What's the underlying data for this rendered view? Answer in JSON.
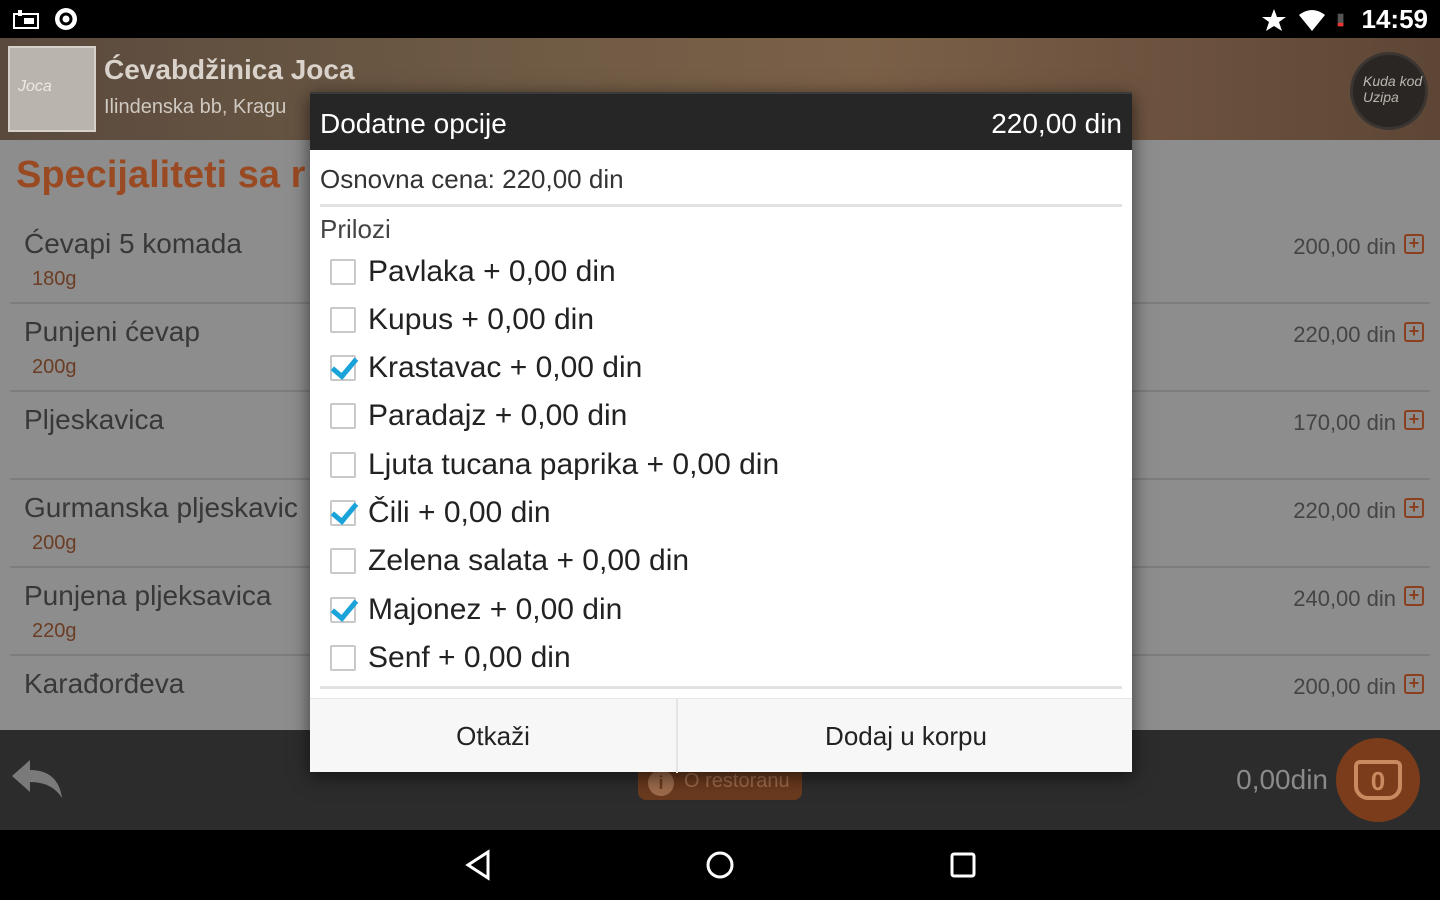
{
  "status_bar": {
    "time": "14:59",
    "left_icons": [
      "storage-icon",
      "sync-icon"
    ],
    "right_icons": [
      "star-icon",
      "wifi-icon",
      "battery-icon"
    ]
  },
  "header": {
    "restaurant_name": "Ćevabdžinica Joca",
    "address": "Ilindenska bb, Kragu",
    "logo_text": "Joca",
    "badge_text": "Kuda kod Uzipa"
  },
  "menu": {
    "section_title": "Specijaliteti sa r",
    "items": [
      {
        "name": "Ćevapi 5 komada",
        "weight": "180g",
        "price": "200,00 din"
      },
      {
        "name": "Punjeni ćevap",
        "weight": "200g",
        "price": "220,00 din"
      },
      {
        "name": "Pljeskavica",
        "weight": "",
        "price": "170,00 din"
      },
      {
        "name": "Gurmanska pljeskavic",
        "weight": "200g",
        "price": "220,00 din"
      },
      {
        "name": "Punjena pljeksavica",
        "weight": "220g",
        "price": "240,00 din"
      },
      {
        "name": "Karađorđeva",
        "weight": "",
        "price": "200,00 din"
      }
    ]
  },
  "bottom_bar": {
    "info_label": "O restoranu",
    "cart_total": "0,00din",
    "cart_count": "0"
  },
  "dialog": {
    "title": "Dodatne opcije",
    "price": "220,00 din",
    "base_price": "Osnovna cena: 220,00 din",
    "group_label": "Prilozi",
    "options": [
      {
        "label": "Pavlaka + 0,00 din",
        "checked": false
      },
      {
        "label": "Kupus + 0,00 din",
        "checked": false
      },
      {
        "label": "Krastavac + 0,00 din",
        "checked": true
      },
      {
        "label": "Paradajz + 0,00 din",
        "checked": false
      },
      {
        "label": "Ljuta tucana paprika + 0,00 din",
        "checked": false
      },
      {
        "label": "Čili + 0,00 din",
        "checked": true
      },
      {
        "label": "Zelena salata + 0,00 din",
        "checked": false
      },
      {
        "label": "Majonez + 0,00 din",
        "checked": true
      },
      {
        "label": "Senf + 0,00 din",
        "checked": false
      }
    ],
    "cancel_label": "Otkaži",
    "confirm_label": "Dodaj u korpu"
  },
  "colors": {
    "accent_check": "#1aa3d9",
    "brand_orange": "#c8531c",
    "dialog_header": "#262626"
  }
}
